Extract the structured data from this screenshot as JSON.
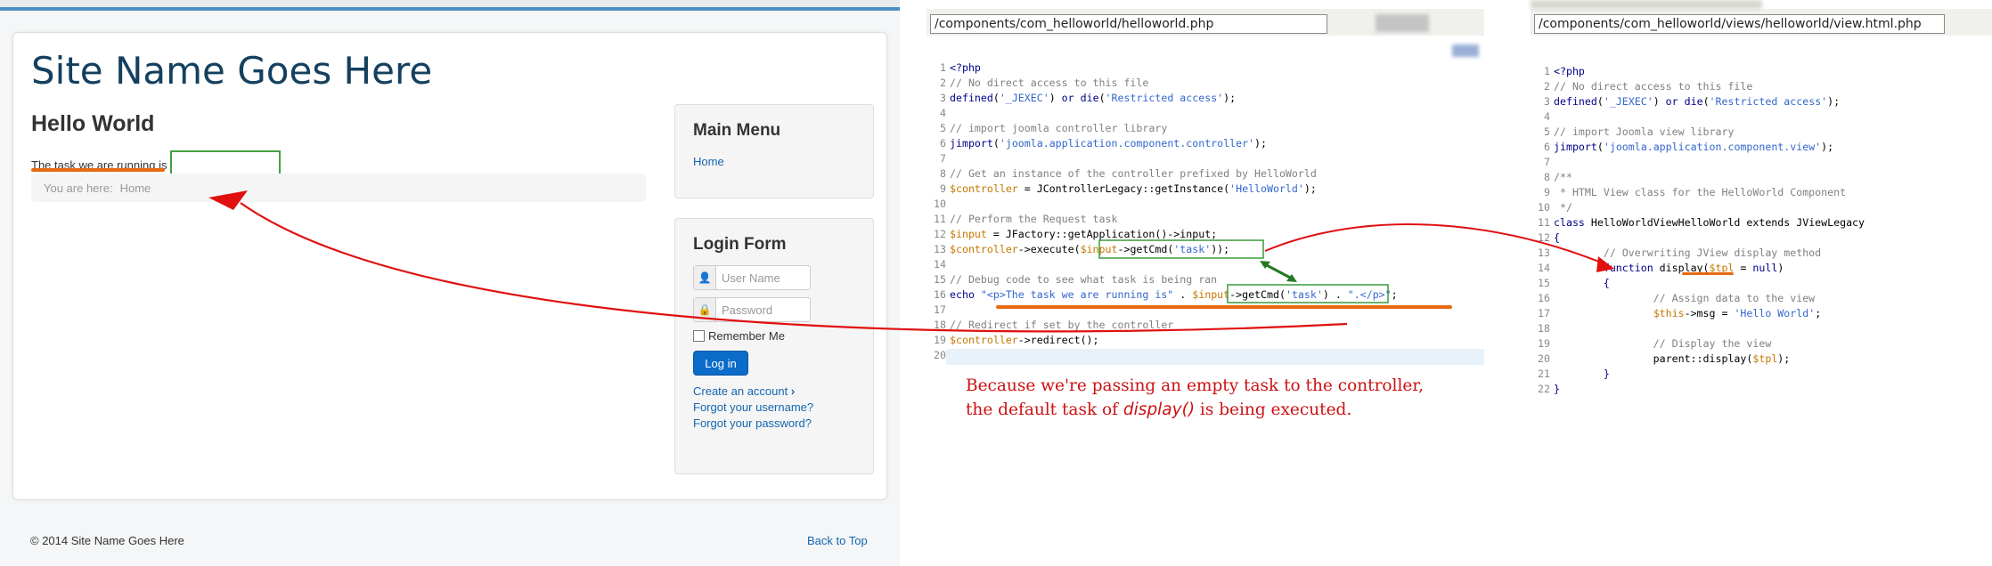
{
  "site": {
    "title": "Site Name Goes Here",
    "page_heading": "Hello World",
    "task_text": "The task we are running is",
    "breadcrumb_label": "You are here:",
    "breadcrumb_home": "Home",
    "main_menu": {
      "title": "Main Menu",
      "items": [
        "Home"
      ]
    },
    "login": {
      "title": "Login Form",
      "username_placeholder": "User Name",
      "password_placeholder": "Password",
      "remember": "Remember Me",
      "button": "Log in",
      "create_account": "Create an account",
      "forgot_username": "Forgot your username?",
      "forgot_password": "Forgot your password?"
    },
    "footer": "© 2014 Site Name Goes Here",
    "back_to_top": "Back to Top"
  },
  "controller_file": {
    "path": "/components/com_helloworld/helloworld.php",
    "lines": [
      [
        [
          "c-kw",
          "<?php"
        ]
      ],
      [
        [
          "c-com",
          "// No direct access to this file"
        ]
      ],
      [
        [
          "c-kw",
          "defined"
        ],
        [
          "c-plain",
          "("
        ],
        [
          "c-str",
          "'_JEXEC'"
        ],
        [
          "c-plain",
          ") "
        ],
        [
          "c-kw",
          "or die"
        ],
        [
          "c-plain",
          "("
        ],
        [
          "c-str",
          "'Restricted access'"
        ],
        [
          "c-plain",
          ");"
        ]
      ],
      [
        [
          "c-plain",
          ""
        ]
      ],
      [
        [
          "c-com",
          "// import joomla controller library"
        ]
      ],
      [
        [
          "c-kw",
          "jimport"
        ],
        [
          "c-plain",
          "("
        ],
        [
          "c-str",
          "'joomla.application.component.controller'"
        ],
        [
          "c-plain",
          ");"
        ]
      ],
      [
        [
          "c-plain",
          ""
        ]
      ],
      [
        [
          "c-com",
          "// Get an instance of the controller prefixed by HelloWorld"
        ]
      ],
      [
        [
          "c-var",
          "$controller"
        ],
        [
          "c-plain",
          " = JControllerLegacy::getInstance("
        ],
        [
          "c-str",
          "'HelloWorld'"
        ],
        [
          "c-plain",
          ");"
        ]
      ],
      [
        [
          "c-plain",
          ""
        ]
      ],
      [
        [
          "c-com",
          "// Perform the Request task"
        ]
      ],
      [
        [
          "c-var",
          "$input"
        ],
        [
          "c-plain",
          " = JFactory::getApplication()->input;"
        ]
      ],
      [
        [
          "c-var",
          "$controller"
        ],
        [
          "c-plain",
          "->execute("
        ],
        [
          "c-var",
          "$input"
        ],
        [
          "c-plain",
          "->getCmd("
        ],
        [
          "c-str",
          "'task'"
        ],
        [
          "c-plain",
          "));"
        ]
      ],
      [
        [
          "c-plain",
          ""
        ]
      ],
      [
        [
          "c-com",
          "// Debug code to see what task is being ran"
        ]
      ],
      [
        [
          "c-kw",
          "echo "
        ],
        [
          "c-str",
          "\"<p>The task we are running is\""
        ],
        [
          "c-plain",
          " . "
        ],
        [
          "c-var",
          "$input"
        ],
        [
          "c-plain",
          "->getCmd("
        ],
        [
          "c-str",
          "'task'"
        ],
        [
          "c-plain",
          ") . "
        ],
        [
          "c-str",
          "\".</p>\""
        ],
        [
          "c-plain",
          ";"
        ]
      ],
      [
        [
          "c-plain",
          ""
        ]
      ],
      [
        [
          "c-com",
          "// Redirect if set by the controller"
        ]
      ],
      [
        [
          "c-var",
          "$controller"
        ],
        [
          "c-plain",
          "->redirect();"
        ]
      ],
      [
        [
          "c-plain",
          ""
        ]
      ]
    ]
  },
  "view_file": {
    "path": "/components/com_helloworld/views/helloworld/view.html.php",
    "lines": [
      [
        [
          "c-kw",
          "<?php"
        ]
      ],
      [
        [
          "c-com",
          "// No direct access to this file"
        ]
      ],
      [
        [
          "c-kw",
          "defined"
        ],
        [
          "c-plain",
          "("
        ],
        [
          "c-str",
          "'_JEXEC'"
        ],
        [
          "c-plain",
          ") "
        ],
        [
          "c-kw",
          "or die"
        ],
        [
          "c-plain",
          "("
        ],
        [
          "c-str",
          "'Restricted access'"
        ],
        [
          "c-plain",
          ");"
        ]
      ],
      [
        [
          "c-plain",
          ""
        ]
      ],
      [
        [
          "c-com",
          "// import Joomla view library"
        ]
      ],
      [
        [
          "c-kw",
          "jimport"
        ],
        [
          "c-plain",
          "("
        ],
        [
          "c-str",
          "'joomla.application.component.view'"
        ],
        [
          "c-plain",
          ");"
        ]
      ],
      [
        [
          "c-plain",
          ""
        ]
      ],
      [
        [
          "c-com",
          "/**"
        ]
      ],
      [
        [
          "c-com",
          " * HTML View class for the HelloWorld Component"
        ]
      ],
      [
        [
          "c-com",
          " */"
        ]
      ],
      [
        [
          "c-kw",
          "class "
        ],
        [
          "c-plain",
          "HelloWorldViewHelloWorld extends JViewLegacy"
        ]
      ],
      [
        [
          "c-kw",
          "{"
        ]
      ],
      [
        [
          "c-com",
          "        // Overwriting JView display method"
        ]
      ],
      [
        [
          "c-kw",
          "        function "
        ],
        [
          "c-plain",
          "display("
        ],
        [
          "c-var",
          "$tpl"
        ],
        [
          "c-plain",
          " = "
        ],
        [
          "c-kw",
          "null"
        ],
        [
          "c-plain",
          ")"
        ]
      ],
      [
        [
          "c-kw",
          "        {"
        ]
      ],
      [
        [
          "c-com",
          "                // Assign data to the view"
        ]
      ],
      [
        [
          "c-plain",
          "                "
        ],
        [
          "c-var",
          "$this"
        ],
        [
          "c-plain",
          "->msg = "
        ],
        [
          "c-str",
          "'Hello World'"
        ],
        [
          "c-plain",
          ";"
        ]
      ],
      [
        [
          "c-plain",
          ""
        ]
      ],
      [
        [
          "c-com",
          "                // Display the view"
        ]
      ],
      [
        [
          "c-plain",
          "                parent::display("
        ],
        [
          "c-var",
          "$tpl"
        ],
        [
          "c-plain",
          ");"
        ]
      ],
      [
        [
          "c-kw",
          "        }"
        ]
      ],
      [
        [
          "c-kw",
          "}"
        ]
      ]
    ]
  },
  "annotation": {
    "line1": "Because we're passing an empty task to the controller,",
    "line2_pre": "the default task of ",
    "line2_em": "display()",
    "line2_post": " is being executed."
  },
  "colors": {
    "arrow": "#e01010",
    "underline": "#e86a10",
    "highlight": "#3a9a3a",
    "link": "#1565b0"
  }
}
